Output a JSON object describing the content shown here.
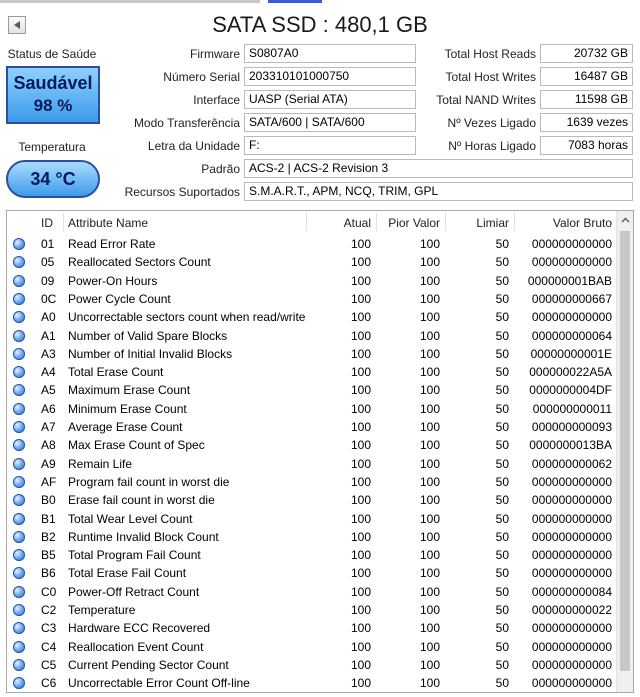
{
  "window": {
    "title": "SATA SSD : 480,1 GB"
  },
  "health": {
    "label": "Status de Saúde",
    "status": "Saudável",
    "percent": "98 %"
  },
  "temperature": {
    "label": "Temperatura",
    "value": "34 °C"
  },
  "info": {
    "firmware": {
      "label": "Firmware",
      "value": "S0807A0"
    },
    "serial": {
      "label": "Número Serial",
      "value": "203310101000750"
    },
    "interface": {
      "label": "Interface",
      "value": "UASP (Serial ATA)"
    },
    "transfer_mode": {
      "label": "Modo Transferência",
      "value": "SATA/600 | SATA/600"
    },
    "drive_letter": {
      "label": "Letra da Unidade",
      "value": "F:"
    },
    "standard": {
      "label": "Padrão",
      "value": "ACS-2 | ACS-2 Revision 3"
    },
    "features": {
      "label": "Recursos Suportados",
      "value": "S.M.A.R.T., APM, NCQ, TRIM, GPL"
    }
  },
  "stats": {
    "host_reads": {
      "label": "Total Host Reads",
      "value": "20732 GB"
    },
    "host_writes": {
      "label": "Total Host Writes",
      "value": "16487 GB"
    },
    "nand_writes": {
      "label": "Total NAND Writes",
      "value": "11598 GB"
    },
    "power_on_count": {
      "label": "Nº Vezes Ligado",
      "value": "1639 vezes"
    },
    "power_on_hours": {
      "label": "Nº Horas Ligado",
      "value": "7083 horas"
    }
  },
  "table": {
    "headers": {
      "id": "ID",
      "name": "Attribute Name",
      "current": "Atual",
      "worst": "Pior Valor",
      "threshold": "Limiar",
      "raw": "Valor Bruto"
    },
    "rows": [
      {
        "id": "01",
        "name": "Read Error Rate",
        "current": "100",
        "worst": "100",
        "threshold": "50",
        "raw": "000000000000"
      },
      {
        "id": "05",
        "name": "Reallocated Sectors Count",
        "current": "100",
        "worst": "100",
        "threshold": "50",
        "raw": "000000000000"
      },
      {
        "id": "09",
        "name": "Power-On Hours",
        "current": "100",
        "worst": "100",
        "threshold": "50",
        "raw": "000000001BAB"
      },
      {
        "id": "0C",
        "name": "Power Cycle Count",
        "current": "100",
        "worst": "100",
        "threshold": "50",
        "raw": "000000000667"
      },
      {
        "id": "A0",
        "name": "Uncorrectable sectors count when read/write",
        "current": "100",
        "worst": "100",
        "threshold": "50",
        "raw": "000000000000"
      },
      {
        "id": "A1",
        "name": "Number of Valid Spare Blocks",
        "current": "100",
        "worst": "100",
        "threshold": "50",
        "raw": "000000000064"
      },
      {
        "id": "A3",
        "name": "Number of Initial Invalid Blocks",
        "current": "100",
        "worst": "100",
        "threshold": "50",
        "raw": "00000000001E"
      },
      {
        "id": "A4",
        "name": "Total Erase Count",
        "current": "100",
        "worst": "100",
        "threshold": "50",
        "raw": "000000022A5A"
      },
      {
        "id": "A5",
        "name": "Maximum Erase Count",
        "current": "100",
        "worst": "100",
        "threshold": "50",
        "raw": "0000000004DF"
      },
      {
        "id": "A6",
        "name": "Minimum Erase Count",
        "current": "100",
        "worst": "100",
        "threshold": "50",
        "raw": "000000000011"
      },
      {
        "id": "A7",
        "name": "Average Erase Count",
        "current": "100",
        "worst": "100",
        "threshold": "50",
        "raw": "000000000093"
      },
      {
        "id": "A8",
        "name": "Max Erase Count of Spec",
        "current": "100",
        "worst": "100",
        "threshold": "50",
        "raw": "0000000013BA"
      },
      {
        "id": "A9",
        "name": "Remain Life",
        "current": "100",
        "worst": "100",
        "threshold": "50",
        "raw": "000000000062"
      },
      {
        "id": "AF",
        "name": "Program fail count in worst die",
        "current": "100",
        "worst": "100",
        "threshold": "50",
        "raw": "000000000000"
      },
      {
        "id": "B0",
        "name": "Erase fail count in worst die",
        "current": "100",
        "worst": "100",
        "threshold": "50",
        "raw": "000000000000"
      },
      {
        "id": "B1",
        "name": "Total Wear Level Count",
        "current": "100",
        "worst": "100",
        "threshold": "50",
        "raw": "000000000000"
      },
      {
        "id": "B2",
        "name": "Runtime Invalid Block Count",
        "current": "100",
        "worst": "100",
        "threshold": "50",
        "raw": "000000000000"
      },
      {
        "id": "B5",
        "name": "Total Program Fail Count",
        "current": "100",
        "worst": "100",
        "threshold": "50",
        "raw": "000000000000"
      },
      {
        "id": "B6",
        "name": "Total Erase Fail Count",
        "current": "100",
        "worst": "100",
        "threshold": "50",
        "raw": "000000000000"
      },
      {
        "id": "C0",
        "name": "Power-Off Retract Count",
        "current": "100",
        "worst": "100",
        "threshold": "50",
        "raw": "000000000084"
      },
      {
        "id": "C2",
        "name": "Temperature",
        "current": "100",
        "worst": "100",
        "threshold": "50",
        "raw": "000000000022"
      },
      {
        "id": "C3",
        "name": "Hardware ECC Recovered",
        "current": "100",
        "worst": "100",
        "threshold": "50",
        "raw": "000000000000"
      },
      {
        "id": "C4",
        "name": "Reallocation Event Count",
        "current": "100",
        "worst": "100",
        "threshold": "50",
        "raw": "000000000000"
      },
      {
        "id": "C5",
        "name": "Current Pending Sector Count",
        "current": "100",
        "worst": "100",
        "threshold": "50",
        "raw": "000000000000"
      },
      {
        "id": "C6",
        "name": "Uncorrectable Error Count Off-line",
        "current": "100",
        "worst": "100",
        "threshold": "50",
        "raw": "000000000000"
      }
    ]
  },
  "icons": {
    "back": "back-arrow-icon",
    "status_dot": "status-good-dot-icon",
    "scroll_up": "chevron-up-icon"
  },
  "colors": {
    "accent": "#3d9be9",
    "border": "#2b4f9e"
  }
}
